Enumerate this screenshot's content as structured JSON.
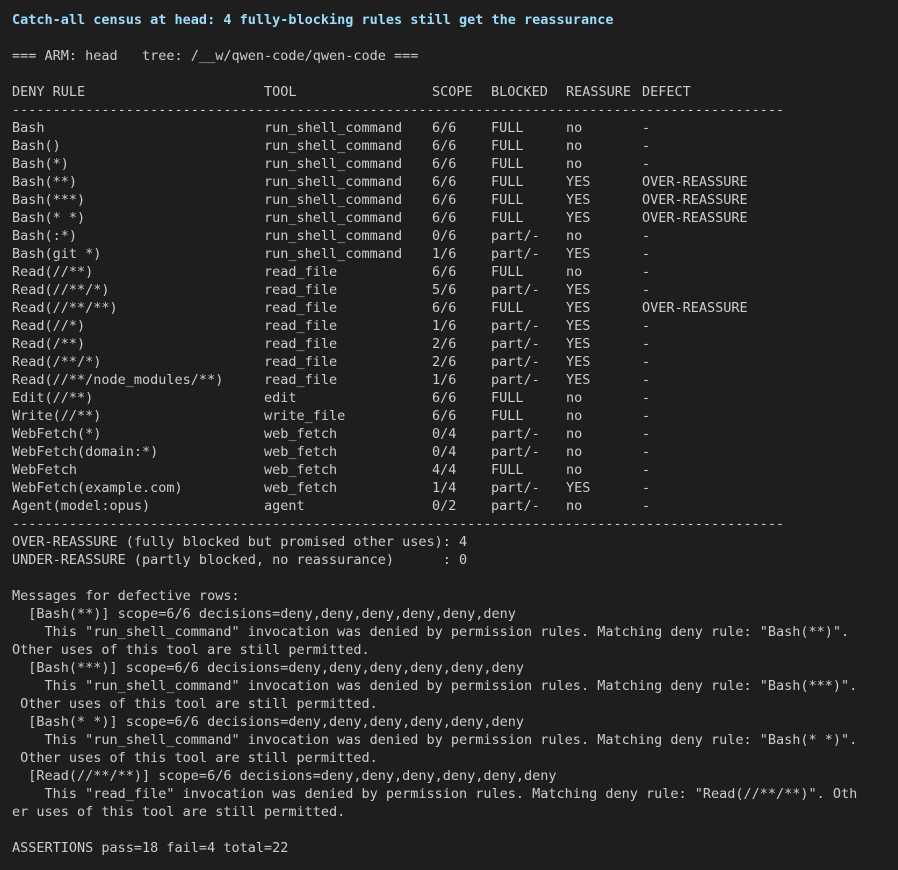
{
  "title": "Catch-all census at head: 4 fully-blocking rules still get the reassurance",
  "arm_line": "=== ARM: head   tree: /__w/qwen-code/qwen-code ===",
  "headers": {
    "rule": "DENY RULE",
    "tool": "TOOL",
    "scope": "SCOPE",
    "blocked": "BLOCKED",
    "reassure": "REASSURE",
    "defect": "DEFECT"
  },
  "separator": "-----------------------------------------------------------------------------------------------",
  "rows": [
    {
      "rule": "Bash",
      "tool": "run_shell_command",
      "scope": "6/6",
      "blocked": "FULL",
      "reassure": "no",
      "defect": "-"
    },
    {
      "rule": "Bash()",
      "tool": "run_shell_command",
      "scope": "6/6",
      "blocked": "FULL",
      "reassure": "no",
      "defect": "-"
    },
    {
      "rule": "Bash(*)",
      "tool": "run_shell_command",
      "scope": "6/6",
      "blocked": "FULL",
      "reassure": "no",
      "defect": "-"
    },
    {
      "rule": "Bash(**)",
      "tool": "run_shell_command",
      "scope": "6/6",
      "blocked": "FULL",
      "reassure": "YES",
      "defect": "OVER-REASSURE"
    },
    {
      "rule": "Bash(***)",
      "tool": "run_shell_command",
      "scope": "6/6",
      "blocked": "FULL",
      "reassure": "YES",
      "defect": "OVER-REASSURE"
    },
    {
      "rule": "Bash(* *)",
      "tool": "run_shell_command",
      "scope": "6/6",
      "blocked": "FULL",
      "reassure": "YES",
      "defect": "OVER-REASSURE"
    },
    {
      "rule": "Bash(:*)",
      "tool": "run_shell_command",
      "scope": "0/6",
      "blocked": "part/-",
      "reassure": "no",
      "defect": "-"
    },
    {
      "rule": "Bash(git *)",
      "tool": "run_shell_command",
      "scope": "1/6",
      "blocked": "part/-",
      "reassure": "YES",
      "defect": "-"
    },
    {
      "rule": "Read(//**)",
      "tool": "read_file",
      "scope": "6/6",
      "blocked": "FULL",
      "reassure": "no",
      "defect": "-"
    },
    {
      "rule": "Read(//**/*)",
      "tool": "read_file",
      "scope": "5/6",
      "blocked": "part/-",
      "reassure": "YES",
      "defect": "-"
    },
    {
      "rule": "Read(//**/**)",
      "tool": "read_file",
      "scope": "6/6",
      "blocked": "FULL",
      "reassure": "YES",
      "defect": "OVER-REASSURE"
    },
    {
      "rule": "Read(//*)",
      "tool": "read_file",
      "scope": "1/6",
      "blocked": "part/-",
      "reassure": "YES",
      "defect": "-"
    },
    {
      "rule": "Read(/**)",
      "tool": "read_file",
      "scope": "2/6",
      "blocked": "part/-",
      "reassure": "YES",
      "defect": "-"
    },
    {
      "rule": "Read(/**/*)",
      "tool": "read_file",
      "scope": "2/6",
      "blocked": "part/-",
      "reassure": "YES",
      "defect": "-"
    },
    {
      "rule": "Read(//**/node_modules/**)",
      "tool": "read_file",
      "scope": "1/6",
      "blocked": "part/-",
      "reassure": "YES",
      "defect": "-"
    },
    {
      "rule": "Edit(//**)",
      "tool": "edit",
      "scope": "6/6",
      "blocked": "FULL",
      "reassure": "no",
      "defect": "-"
    },
    {
      "rule": "Write(//**)",
      "tool": "write_file",
      "scope": "6/6",
      "blocked": "FULL",
      "reassure": "no",
      "defect": "-"
    },
    {
      "rule": "WebFetch(*)",
      "tool": "web_fetch",
      "scope": "0/4",
      "blocked": "part/-",
      "reassure": "no",
      "defect": "-"
    },
    {
      "rule": "WebFetch(domain:*)",
      "tool": "web_fetch",
      "scope": "0/4",
      "blocked": "part/-",
      "reassure": "no",
      "defect": "-"
    },
    {
      "rule": "WebFetch",
      "tool": "web_fetch",
      "scope": "4/4",
      "blocked": "FULL",
      "reassure": "no",
      "defect": "-"
    },
    {
      "rule": "WebFetch(example.com)",
      "tool": "web_fetch",
      "scope": "1/4",
      "blocked": "part/-",
      "reassure": "YES",
      "defect": "-"
    },
    {
      "rule": "Agent(model:opus)",
      "tool": "agent",
      "scope": "0/2",
      "blocked": "part/-",
      "reassure": "no",
      "defect": "-"
    }
  ],
  "summary": [
    "OVER-REASSURE (fully blocked but promised other uses): 4",
    "UNDER-REASSURE (partly blocked, no reassurance)      : 0"
  ],
  "messages_header": "Messages for defective rows:",
  "messages": [
    "  [Bash(**)] scope=6/6 decisions=deny,deny,deny,deny,deny,deny",
    "    This \"run_shell_command\" invocation was denied by permission rules. Matching deny rule: \"Bash(**)\".",
    "Other uses of this tool are still permitted.",
    "  [Bash(***)] scope=6/6 decisions=deny,deny,deny,deny,deny,deny",
    "    This \"run_shell_command\" invocation was denied by permission rules. Matching deny rule: \"Bash(***)\".",
    " Other uses of this tool are still permitted.",
    "  [Bash(* *)] scope=6/6 decisions=deny,deny,deny,deny,deny,deny",
    "    This \"run_shell_command\" invocation was denied by permission rules. Matching deny rule: \"Bash(* *)\".",
    " Other uses of this tool are still permitted.",
    "  [Read(//**/**)] scope=6/6 decisions=deny,deny,deny,deny,deny,deny",
    "    This \"read_file\" invocation was denied by permission rules. Matching deny rule: \"Read(//**/**)\". Oth",
    "er uses of this tool are still permitted."
  ],
  "assertions": "ASSERTIONS pass=18 fail=4 total=22"
}
